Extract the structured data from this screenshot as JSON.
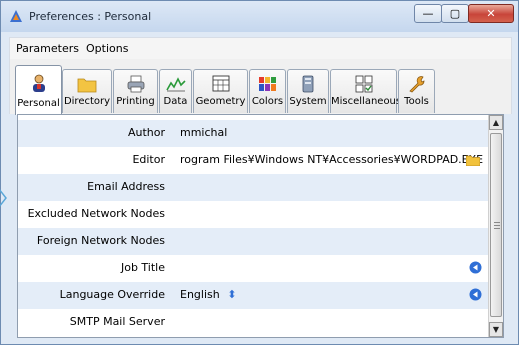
{
  "window": {
    "title": "Preferences : Personal",
    "controls": {
      "minimize": "—",
      "maximize": "▢",
      "close": "✕"
    }
  },
  "menu": [
    "Parameters",
    "Options"
  ],
  "tabs": [
    {
      "label": "Personal",
      "icon": "person-icon",
      "active": true
    },
    {
      "label": "Directory",
      "icon": "folder-icon"
    },
    {
      "label": "Printing",
      "icon": "printer-icon"
    },
    {
      "label": "Data",
      "icon": "chart-icon"
    },
    {
      "label": "Geometry",
      "icon": "grid-icon"
    },
    {
      "label": "Colors",
      "icon": "palette-icon"
    },
    {
      "label": "System",
      "icon": "system-icon"
    },
    {
      "label": "Miscellaneous",
      "icon": "checklist-icon"
    },
    {
      "label": "Tools",
      "icon": "wrench-icon"
    }
  ],
  "fields": [
    {
      "label": "Author",
      "value": "mmichal"
    },
    {
      "label": "Editor",
      "value": "rogram Files¥Windows NT¥Accessories¥WORDPAD.EXE",
      "action": "folder-icon"
    },
    {
      "label": "Email Address",
      "value": ""
    },
    {
      "label": "Excluded Network Nodes",
      "value": ""
    },
    {
      "label": "Foreign Network Nodes",
      "value": ""
    },
    {
      "label": "Job Title",
      "value": "",
      "action": "reset-icon"
    },
    {
      "label": "Language Override",
      "value": "English",
      "spinner": "⬍",
      "action": "reset-icon"
    },
    {
      "label": "SMTP Mail Server",
      "value": ""
    }
  ],
  "colors": {
    "accent": "#2f6fd6",
    "folder": "#f2c23c"
  }
}
